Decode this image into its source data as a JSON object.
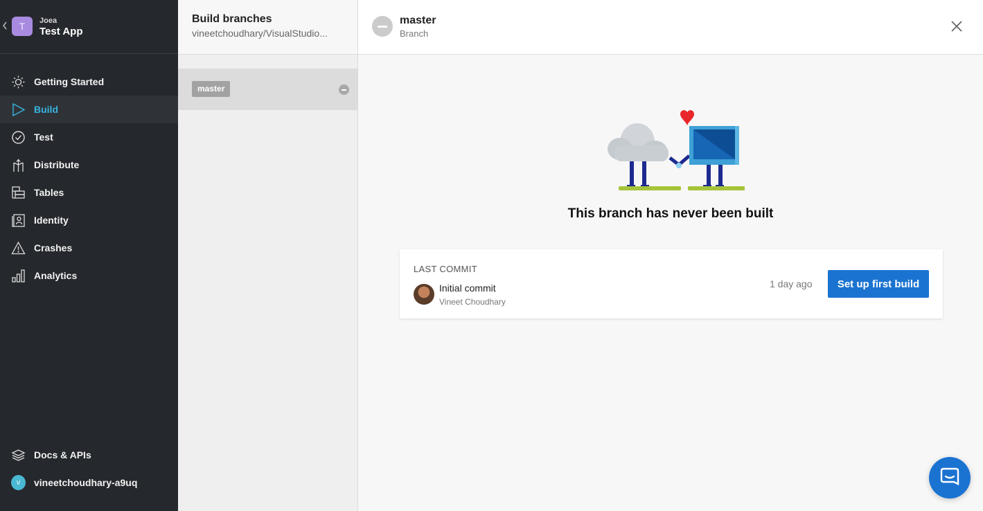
{
  "app": {
    "owner": "Joea",
    "name": "Test App",
    "avatar_letter": "T"
  },
  "nav": {
    "items": [
      {
        "label": "Getting Started",
        "icon": "sun-icon"
      },
      {
        "label": "Build",
        "icon": "play-icon",
        "active": true
      },
      {
        "label": "Test",
        "icon": "check-circle-icon"
      },
      {
        "label": "Distribute",
        "icon": "distribute-icon"
      },
      {
        "label": "Tables",
        "icon": "table-icon"
      },
      {
        "label": "Identity",
        "icon": "identity-icon"
      },
      {
        "label": "Crashes",
        "icon": "warning-icon"
      },
      {
        "label": "Analytics",
        "icon": "bar-chart-icon"
      }
    ],
    "docs_label": "Docs & APIs",
    "user": {
      "name": "vineetchoudhary-a9uq",
      "avatar_letter": "v"
    }
  },
  "branches": {
    "title": "Build branches",
    "repo": "vineetchoudhary/VisualStudio...",
    "items": [
      {
        "name": "master"
      }
    ]
  },
  "main": {
    "branch_name": "master",
    "branch_label": "Branch",
    "empty_title": "This branch has never been built",
    "commit": {
      "section_label": "LAST COMMIT",
      "message": "Initial commit",
      "author": "Vineet Choudhary",
      "time": "1 day ago",
      "action_label": "Set up first build"
    }
  },
  "colors": {
    "sidebar": "#25282c",
    "accent": "#38b4e0",
    "primary_button": "#1a73d1"
  }
}
